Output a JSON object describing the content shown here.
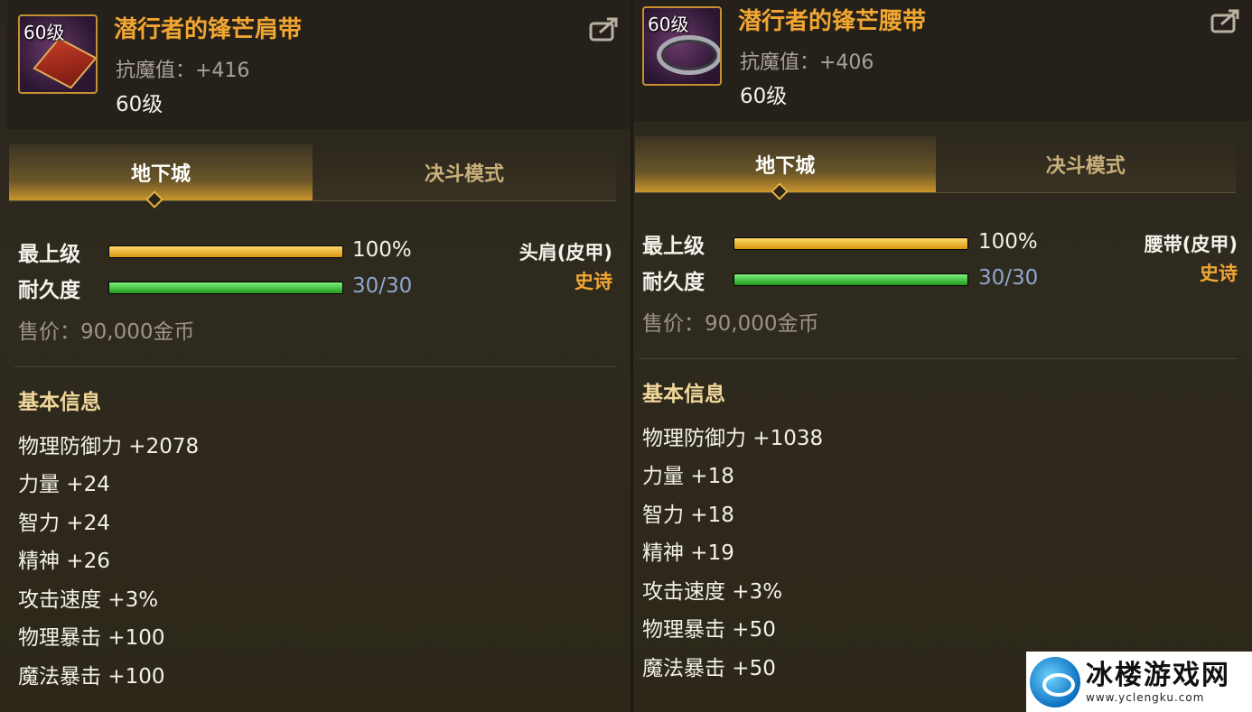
{
  "left": {
    "icon_level": "60级",
    "name": "潜行者的锋芒肩带",
    "anti_magic": "抗魔值：+416",
    "level": "60级",
    "tabs": [
      "地下城",
      "决斗模式"
    ],
    "top_label": "最上级",
    "top_pct": "100%",
    "top_fill": 1.0,
    "durability_label": "耐久度",
    "durability": "30/30",
    "durability_fill": 1.0,
    "slot": "头肩(皮甲)",
    "rarity": "史诗",
    "price": "售价：90,000金币",
    "section": "基本信息",
    "attrs": [
      "物理防御力 +2078",
      "力量 +24",
      "智力 +24",
      "精神 +26",
      "攻击速度 +3%",
      "物理暴击 +100",
      "魔法暴击 +100"
    ]
  },
  "right": {
    "icon_level": "60级",
    "name": "潜行者的锋芒腰带",
    "anti_magic": "抗魔值：+406",
    "level": "60级",
    "tabs": [
      "地下城",
      "决斗模式"
    ],
    "top_label": "最上级",
    "top_pct": "100%",
    "top_fill": 1.0,
    "durability_label": "耐久度",
    "durability": "30/30",
    "durability_fill": 1.0,
    "slot": "腰带(皮甲)",
    "rarity": "史诗",
    "price": "售价：90,000金币",
    "section": "基本信息",
    "attrs": [
      "物理防御力 +1038",
      "力量 +18",
      "智力 +18",
      "精神 +19",
      "攻击速度 +3%",
      "物理暴击 +50",
      "魔法暴击 +50"
    ]
  },
  "watermark": {
    "title": "冰楼游戏网",
    "url": "www.yclengku.com"
  },
  "colors": {
    "item_name": "#f2a632",
    "rarity_epic": "#f2a632",
    "durability_text": "#8fa6d0",
    "bar_gold": "#d9960f",
    "bar_green": "#1f9a1d"
  },
  "icons": {
    "share": "share-export-icon",
    "left_item": "shoulder-cape-icon",
    "right_item": "belt-icon"
  }
}
